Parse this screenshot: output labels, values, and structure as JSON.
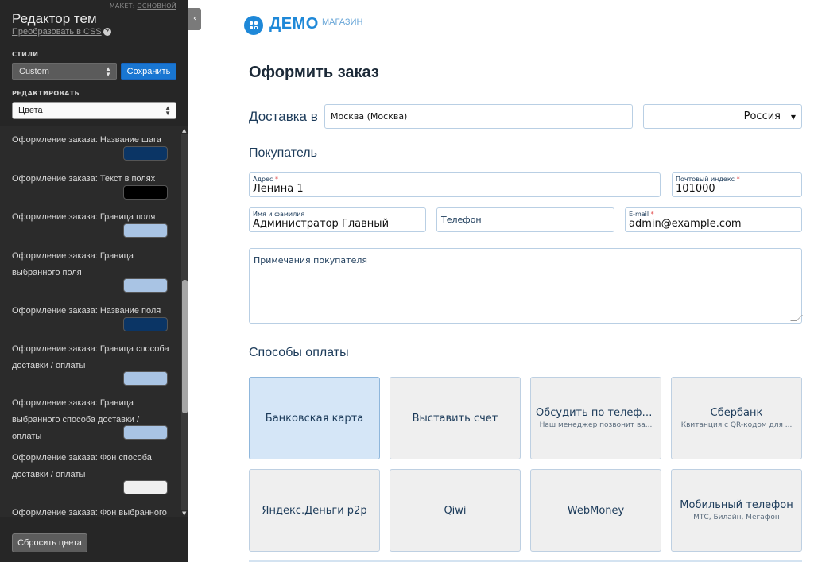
{
  "editor": {
    "layout_prefix": "МАКЕТ:",
    "layout_link": "ОСНОВНОЙ",
    "title": "Редактор тем",
    "css_link": "Преобразовать в CSS",
    "styles_label": "СТИЛИ",
    "styles_value": "Custom",
    "save_label": "Сохранить",
    "edit_label": "РЕДАКТИРОВАТЬ",
    "edit_value": "Цвета",
    "reset_label": "Сбросить цвета",
    "colors": [
      {
        "line1": "Оформление заказа: Название шага",
        "line2": "",
        "color": "#0b3565"
      },
      {
        "line1": "Оформление заказа: Текст в полях",
        "line2": "",
        "color": "#000000"
      },
      {
        "line1": "Оформление заказа: Граница поля",
        "line2": "",
        "color": "#a9c4e4"
      },
      {
        "line1": "Оформление заказа: Граница",
        "line2": "выбранного поля",
        "color": "#a9c4e4"
      },
      {
        "line1": "Оформление заказа: Название поля",
        "line2": "",
        "color": "#0b3565"
      },
      {
        "line1": "Оформление заказа: Граница способа",
        "line2": "доставки / оплаты",
        "color": "#a9c4e4"
      },
      {
        "line1": "Оформление заказа: Граница",
        "line2": "выбранного способа доставки / оплаты",
        "color": "#a9c4e4"
      },
      {
        "line1": "Оформление заказа: Фон способа",
        "line2": "доставки / оплаты",
        "color": "#efefef"
      },
      {
        "line1": "Оформление заказа: Фон выбранного",
        "line2": "",
        "color": "#d5e6f7"
      }
    ]
  },
  "logo": {
    "word": "ДЕМО",
    "sub": "МАГАЗИН"
  },
  "checkout": {
    "title": "Оформить заказ",
    "delivery_label": "Доставка в",
    "city_value": "Москва (Москва)",
    "country_value": "Россия",
    "buyer_label": "Покупатель",
    "address_label": "Адрес",
    "address_value": "Ленина 1",
    "zip_label": "Почтовый индекс",
    "zip_value": "101000",
    "name_label": "Имя и фамилия",
    "name_value": "Администратор Главный",
    "phone_placeholder": "Телефон",
    "email_label": "E-mail",
    "email_value": "admin@example.com",
    "notes_placeholder": "Примечания покупателя",
    "required_mark": "*",
    "payment_label": "Способы оплаты",
    "payments": [
      {
        "name": "Банковская карта",
        "desc": "",
        "active": true
      },
      {
        "name": "Выставить счет",
        "desc": "",
        "active": false
      },
      {
        "name": "Обсудить по телефону",
        "desc": "Наш менеджер позвонит ва...",
        "active": false
      },
      {
        "name": "Сбербанк",
        "desc": "Квитанция с QR-кодом для ...",
        "active": false
      },
      {
        "name": "Яндекс.Деньги p2p",
        "desc": "",
        "active": false
      },
      {
        "name": "Qiwi",
        "desc": "",
        "active": false
      },
      {
        "name": "WebMoney",
        "desc": "",
        "active": false
      },
      {
        "name": "Мобильный телефон",
        "desc": "МТС, Билайн, Мегафон",
        "active": false
      }
    ]
  }
}
